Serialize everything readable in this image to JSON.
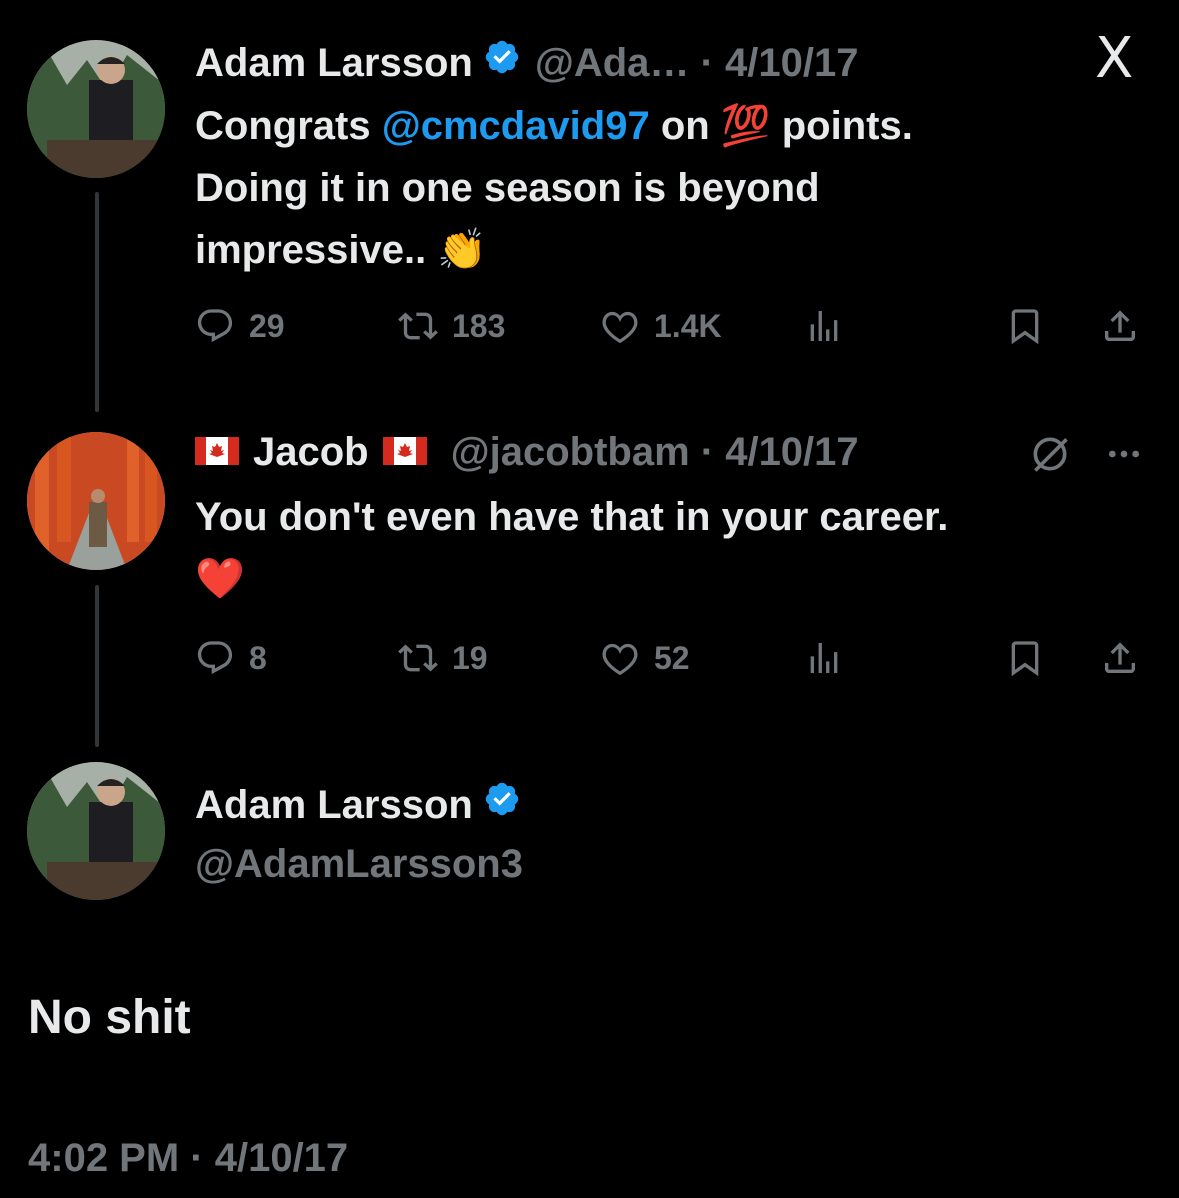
{
  "app": {
    "x_logo": "X"
  },
  "tweet1": {
    "name": "Adam Larsson",
    "handle": "@Ada…",
    "date": "4/10/17",
    "text_pre": "Congrats ",
    "mention": "@cmcdavid97",
    "text_mid": " on ",
    "emoji_hundred": "💯",
    "text_post": " points.",
    "line2": "Doing it in one season is beyond",
    "line3": "impressive.. ",
    "emoji_clap": "👏",
    "replies": "29",
    "reposts": "183",
    "likes": "1.4K"
  },
  "tweet2": {
    "name": "Jacob",
    "handle": "@jacobtbam",
    "date": "4/10/17",
    "line1": "You don't even have that in your career.",
    "emoji_heart": "❤️",
    "replies": "8",
    "reposts": "19",
    "likes": "52"
  },
  "tweet3": {
    "name": "Adam Larsson",
    "handle": "@AdamLarsson3",
    "text": "No shit",
    "time": "4:02 PM",
    "date": "4/10/17"
  },
  "colors": {
    "accent": "#1d9bf0",
    "muted": "#71767b",
    "text": "#e7e9ea",
    "bg": "#000000"
  },
  "icons": [
    "reply-icon",
    "repost-icon",
    "like-icon",
    "views-icon",
    "bookmark-icon",
    "share-icon",
    "verified-badge-icon",
    "canada-flag-icon",
    "grok-icon",
    "more-icon",
    "x-logo-icon"
  ]
}
